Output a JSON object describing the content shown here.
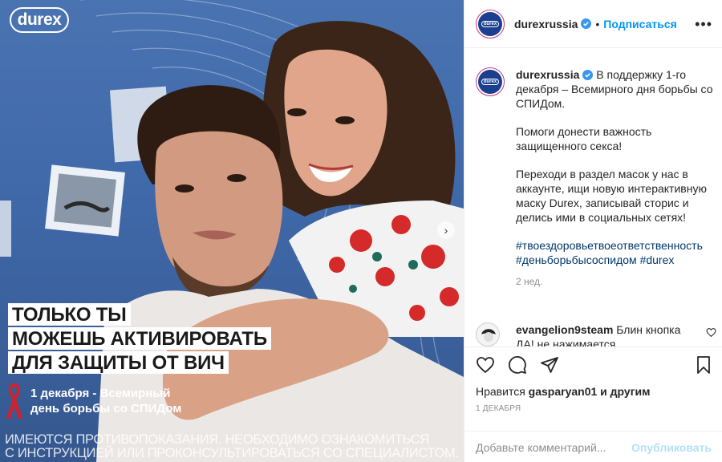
{
  "media": {
    "brand_logo": "durex",
    "headline": [
      "ТОЛЬКО ТЫ",
      "МОЖЕШЬ АКТИВИРОВАТЬ",
      "ДЛЯ ЗАЩИТЫ ОТ ВИЧ"
    ],
    "date_line1": "1 декабря - Всемирный",
    "date_line2": "день борьбы со СПИДом",
    "warning_line1": "ИМЕЮТСЯ ПРОТИВОПОКАЗАНИЯ. НЕОБХОДИМО ОЗНАКОМИТЬСЯ",
    "warning_line2": "С ИНСТРУКЦИЕЙ ИЛИ ПРОКОНСУЛЬТИРОВАТЬСЯ СО СПЕЦИАЛИСТОМ.",
    "next_icon": "chevron-right-icon",
    "bg_color": "#4a73b2"
  },
  "header": {
    "username": "durexrussia",
    "separator": "•",
    "follow_label": "Подписаться",
    "more_icon": "more-horizontal-icon",
    "accent": "#0095f6"
  },
  "caption": {
    "username": "durexrussia",
    "p1": "В поддержку 1-го декабря – Всемирного дня борьбы со СПИДом.",
    "p2": "Помоги донести важность защищенного секса!",
    "p3": "Переходи в раздел масок у нас в аккаунте, ищи новую интерактивную маску Durex, записывай сторис и делись ими в социальных сетях!",
    "tag1": "#твоездоровьетвоеответственность",
    "tag2": "#деньборьбысоспидом",
    "tag3": "#durex",
    "time": "2 нед."
  },
  "comment": {
    "username": "evangelion9steam",
    "text": "Блин кнопка ДА! не нажимается"
  },
  "actions": {
    "likes_prefix": "Нравится",
    "likes_user": "gasparyan01",
    "likes_suffix": "и другим",
    "date": "1 ДЕКАБРЯ"
  },
  "add_comment": {
    "placeholder": "Добавьте комментарий...",
    "publish_label": "Опубликовать"
  }
}
